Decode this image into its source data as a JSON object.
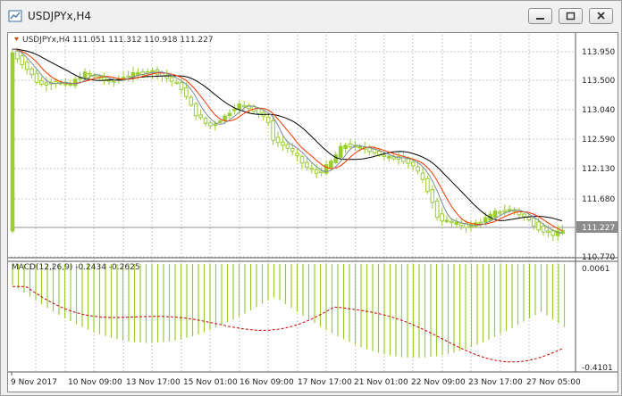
{
  "window": {
    "title": "USDJPYx,H4"
  },
  "chart": {
    "symbol_line": "USDJPYx,H4  111.051 111.312 110.918 111.227",
    "current_price": "111.227",
    "price_ticks": [
      "113.950",
      "113.500",
      "113.040",
      "112.590",
      "112.130",
      "111.680",
      "110.770"
    ],
    "macd_label": "MACD(12,26,9) -0.2434 -0.2625",
    "macd_ticks": [
      "0.0061",
      "-0.4101"
    ],
    "time_labels": [
      "9 Nov 2017",
      "10 Nov 09:00",
      "13 Nov 17:00",
      "15 Nov 01:00",
      "16 Nov 09:00",
      "17 Nov 17:00",
      "21 Nov 01:00",
      "22 Nov 09:00",
      "23 Nov 17:00",
      "27 Nov 05:00"
    ],
    "colors": {
      "bull": "#9acd32",
      "ma_black": "#000000",
      "ma_red": "#ff3300",
      "ma_gray": "#7a8a9a",
      "signal": "#cc0000"
    }
  }
}
